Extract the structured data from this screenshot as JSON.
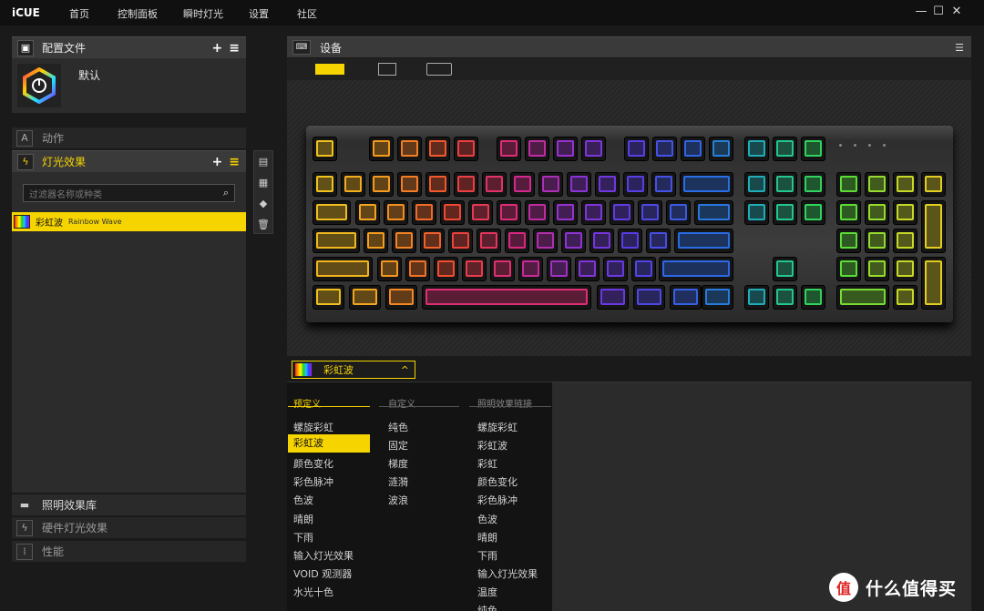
{
  "app": {
    "logo": "iCUE"
  },
  "nav": [
    "首页",
    "控制面板",
    "瞬时灯光",
    "设置",
    "社区"
  ],
  "window_controls": {
    "minimize": "—",
    "maximize": "☐",
    "close": "✕"
  },
  "profiles": {
    "title": "配置文件",
    "add": "+",
    "menu": "≡",
    "default_profile": "默认"
  },
  "sections": {
    "actions": "动作",
    "lighting": "灯光效果",
    "lighting_library": "照明效果库",
    "hardware_lighting": "硬件灯光效果",
    "performance": "性能"
  },
  "filter": {
    "placeholder": "过滤器名称或种类"
  },
  "active_effect": {
    "name": "彩虹波",
    "type": "Rainbow Wave"
  },
  "device": {
    "title": "设备"
  },
  "effect_dropdown": {
    "label": "彩虹波",
    "chevron": "^"
  },
  "columns": {
    "predefined": {
      "title": "预定义",
      "items": [
        "螺旋彩虹",
        "彩虹波",
        "颜色变化",
        "彩色脉冲",
        "色波",
        "晴朗",
        "下雨",
        "输入灯光效果",
        "VOID 观测器",
        "水光十色"
      ],
      "selected": "彩虹波"
    },
    "custom": {
      "title": "自定义",
      "items": [
        "纯色",
        "固定",
        "梯度",
        "涟漪",
        "波浪"
      ]
    },
    "linked": {
      "title": "照明效果链接",
      "items": [
        "螺旋彩虹",
        "彩虹波",
        "彩虹",
        "颜色变化",
        "彩色脉冲",
        "色波",
        "晴朗",
        "下雨",
        "输入灯光效果",
        "温度",
        "纯色"
      ]
    }
  },
  "watermark": {
    "logo": "值",
    "text": "什么值得买"
  },
  "colors": {
    "accent": "#f5d400",
    "bg": "#1a1a1a",
    "panel": "#2c2c2c"
  }
}
